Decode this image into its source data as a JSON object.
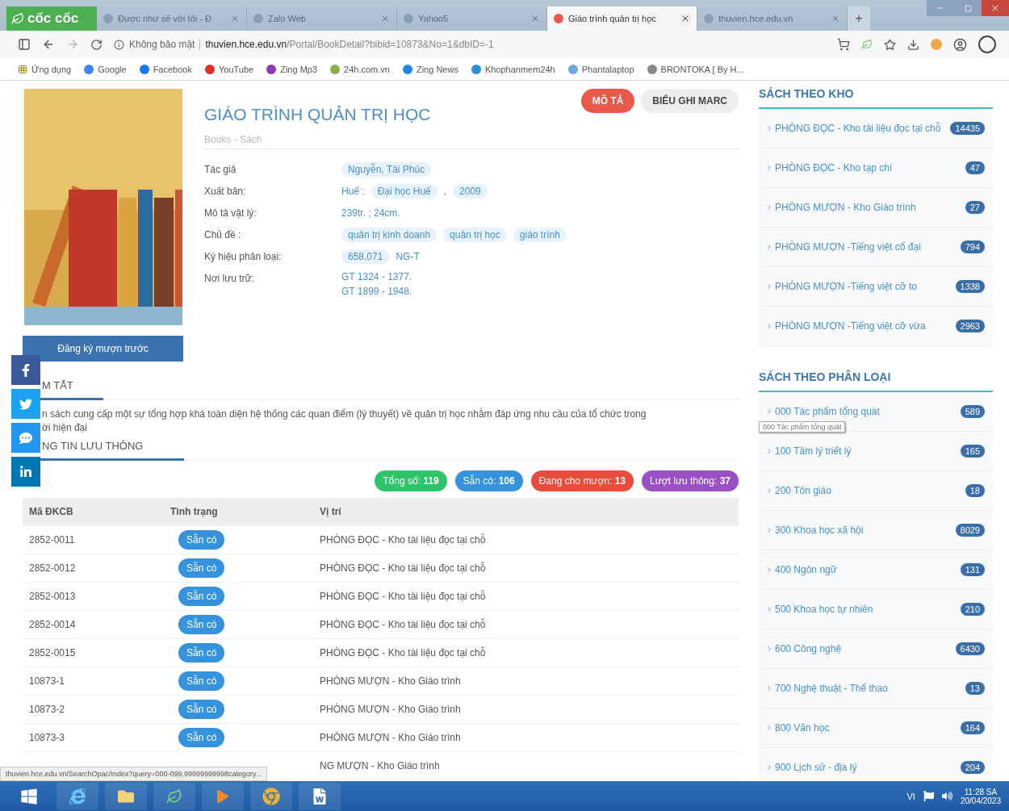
{
  "browser": {
    "brand": "cốc cốc",
    "tabs": [
      {
        "title": "Được như sẽ với tôi - Đ",
        "selected": false
      },
      {
        "title": "Zalo Web",
        "selected": false
      },
      {
        "title": "Yahoo5",
        "selected": false
      },
      {
        "title": "Giáo trình quản trị học",
        "selected": true
      },
      {
        "title": "thuvien.hce.edu.vn",
        "selected": false
      }
    ],
    "new_tab": "+",
    "address": {
      "security": "Không bảo mật",
      "host": "thuvien.hce.edu.vn",
      "path": "/Portal/BookDetail?bibid=10873&No=1&dbID=-1"
    },
    "bookmarks": [
      {
        "label": "Ứng dụng",
        "color": "#c0803a"
      },
      {
        "label": "Google",
        "color": "#4285f4"
      },
      {
        "label": "Facebook",
        "color": "#1877f2"
      },
      {
        "label": "YouTube",
        "color": "#e52d27"
      },
      {
        "label": "Zing Mp3",
        "color": "#8e3ab8"
      },
      {
        "label": "24h.com.vn",
        "color": "#8bb04a"
      },
      {
        "label": "Zing News",
        "color": "#1e88e5"
      },
      {
        "label": "Khophanmem24h",
        "color": "#2a8fd8"
      },
      {
        "label": "Phantalaptop",
        "color": "#6fa8dc"
      },
      {
        "label": "BRONTOKA [ By H...",
        "color": "#888888"
      }
    ]
  },
  "book": {
    "title": "GIÁO TRÌNH QUẢN TRỊ HỌC",
    "type": "Books - Sách",
    "tabs": [
      {
        "label": "MÔ TẢ",
        "selected": true
      },
      {
        "label": "BIỂU GHI MARC",
        "selected": false
      }
    ],
    "reserve_button": "Đăng ký mượn trước",
    "fields": [
      {
        "label": "Tác giả",
        "values": [
          {
            "kind": "tag",
            "text": "Nguyễn, Tài Phúc"
          }
        ]
      },
      {
        "label": "Xuất bản:",
        "values": [
          {
            "kind": "plain",
            "text": "Huế :"
          },
          {
            "kind": "tag",
            "text": "Đại học Huế"
          },
          {
            "kind": "plain",
            "text": ","
          },
          {
            "kind": "tag",
            "text": "2009"
          }
        ]
      },
      {
        "label": "Mô tả vật lý:",
        "values": [
          {
            "kind": "plain",
            "text": "239tr. ; 24cm."
          }
        ]
      },
      {
        "label": "Chủ đề :",
        "values": [
          {
            "kind": "tag",
            "text": "quản trị kinh doanh"
          },
          {
            "kind": "tag",
            "text": "quản trị học"
          },
          {
            "kind": "tag",
            "text": "giáo trình"
          }
        ]
      },
      {
        "label": "Ký hiệu phân loại:",
        "values": [
          {
            "kind": "tag",
            "text": "658.071"
          },
          {
            "kind": "plain",
            "text": "NG-T"
          }
        ]
      },
      {
        "label": "Nơi lưu trữ:",
        "values": [
          {
            "kind": "line",
            "text": "GT 1324 - 1377."
          },
          {
            "kind": "line",
            "text": "GT 1899 - 1948."
          }
        ]
      }
    ]
  },
  "summary": {
    "title": "M TẮT",
    "lines": [
      "n sách cung cấp một sự tổng hợp khá toàn diện hệ thống các quan điểm (lý thuyết) về quản trị học nhằm đáp ứng nhu cầu của tổ chức trong",
      "ời hiện đại"
    ]
  },
  "circulation": {
    "title": "NG TIN LƯU THÔNG",
    "stats": [
      {
        "text": "Tổng số: **119**",
        "color": "#2ec46a"
      },
      {
        "text": "Sẵn có: **106**",
        "color": "#3592dc"
      },
      {
        "text": "Đang cho mượn: **13**",
        "color": "#e84c3d"
      },
      {
        "text": "Lượt lưu thông: **37**",
        "color": "#9b4fc4"
      }
    ],
    "table": {
      "columns": [
        "Mã ĐKCB",
        "Tình trạng",
        "Vị trí"
      ],
      "rows": [
        {
          "code": "2852-0011",
          "status": "Sẵn có",
          "location": "PHÒNG ĐỌC - Kho tài liệu đọc tại chỗ"
        },
        {
          "code": "2852-0012",
          "status": "Sẵn có",
          "location": "PHÒNG ĐỌC - Kho tài liệu đọc tại chỗ"
        },
        {
          "code": "2852-0013",
          "status": "Sẵn có",
          "location": "PHÒNG ĐỌC - Kho tài liệu đọc tại chỗ"
        },
        {
          "code": "2852-0014",
          "status": "Sẵn có",
          "location": "PHÒNG ĐỌC - Kho tài liệu đọc tại chỗ"
        },
        {
          "code": "2852-0015",
          "status": "Sẵn có",
          "location": "PHÒNG ĐỌC - Kho tài liệu đọc tại chỗ"
        },
        {
          "code": "10873-1",
          "status": "Sẵn có",
          "location": "PHÒNG MƯỢN - Kho Giáo trình"
        },
        {
          "code": "10873-2",
          "status": "Sẵn có",
          "location": "PHÒNG MƯỢN - Kho Giáo trình"
        },
        {
          "code": "10873-3",
          "status": "Sẵn có",
          "location": "PHÒNG MƯỢN - Kho Giáo trình"
        },
        {
          "location": "NG MƯỢN - Kho Giáo trình"
        }
      ]
    }
  },
  "status_url": "thuvien.hce.edu.vn/SearchOpac/Index?query=000-099,99999999998category...",
  "sidebar": {
    "sections": [
      {
        "title": "SÁCH THEO KHO",
        "items": [
          {
            "label": "PHÒNG ĐỌC - Kho tài liệu đọc tại chỗ",
            "count": "14435"
          },
          {
            "label": "PHÒNG ĐỌC - Kho tạp chí",
            "count": "47"
          },
          {
            "label": "PHÒNG MƯỢN - Kho Giáo trình",
            "count": "27"
          },
          {
            "label": "PHÒNG MƯỢN -Tiếng việt cổ đại",
            "count": "794"
          },
          {
            "label": "PHÒNG MƯỢN -Tiếng việt cỡ to",
            "count": "1338"
          },
          {
            "label": "PHÒNG MƯỢN -Tiếng việt cỡ vừa",
            "count": "2963"
          }
        ]
      },
      {
        "title": "SÁCH THEO PHÂN LOẠI",
        "items": [
          {
            "label": "000 Tác phẩm tổng quát",
            "count": "589"
          },
          {
            "label": "100 Tâm lý triết lý",
            "count": "165"
          },
          {
            "label": "200 Tôn giáo",
            "count": "18"
          },
          {
            "label": "300 Khoa học xã hội",
            "count": "8029"
          },
          {
            "label": "400 Ngôn ngữ",
            "count": "131"
          },
          {
            "label": "500 Khoa học tự nhiên",
            "count": "210"
          },
          {
            "label": "600 Công nghệ",
            "count": "6430"
          },
          {
            "label": "700 Nghệ thuật - Thể thao",
            "count": "13"
          },
          {
            "label": "800 Văn học",
            "count": "164"
          },
          {
            "label": "900 Lịch sử - địa lý",
            "count": "204"
          }
        ]
      }
    ]
  },
  "tooltip": "000 Tác phẩm tổng quát",
  "taskbar": {
    "language": "VI",
    "time": "11:28 SA",
    "date": "20/04/2023"
  }
}
